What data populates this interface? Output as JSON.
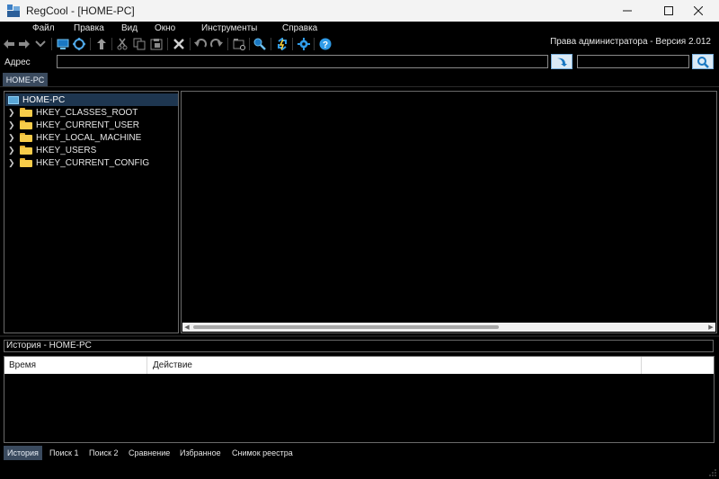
{
  "window": {
    "title": "RegCool - [HOME-PC]",
    "app_icon": "regcool-icon",
    "controls": [
      "minimize-icon",
      "maximize-icon",
      "close-icon"
    ]
  },
  "menu": {
    "items": [
      "Файл",
      "Правка",
      "Вид",
      "Окно",
      "Инструменты",
      "Справка"
    ]
  },
  "toolbar": {
    "buttons": [
      "back-icon",
      "forward-icon",
      "history-dropdown-icon",
      "computer-icon",
      "network-icon",
      "up-icon",
      "cut-icon",
      "copy-icon",
      "paste-icon",
      "delete-icon",
      "undo-icon",
      "redo-icon",
      "new-key-icon",
      "find-icon",
      "refresh-icon",
      "settings-icon",
      "help-icon"
    ],
    "version_text": "Права администратора - Версия 2.012"
  },
  "address": {
    "label": "Адрес",
    "value": "",
    "search_value": ""
  },
  "document_tab": "HOME-PC",
  "tree": {
    "root": "HOME-PC",
    "items": [
      "HKEY_CLASSES_ROOT",
      "HKEY_CURRENT_USER",
      "HKEY_LOCAL_MACHINE",
      "HKEY_USERS",
      "HKEY_CURRENT_CONFIG"
    ]
  },
  "history": {
    "title": "История - HOME-PC",
    "columns": [
      "Время",
      "Действие",
      ""
    ],
    "rows": []
  },
  "bottom_tabs": {
    "items": [
      "История",
      "Поиск 1",
      "Поиск 2",
      "Сравнение",
      "Избранное",
      "Снимок реестра"
    ],
    "active": "История"
  },
  "colors": {
    "background": "#000000",
    "accent": "#1e88e5",
    "selection": "#1e3650",
    "active_tab": "#3a4a5e"
  }
}
